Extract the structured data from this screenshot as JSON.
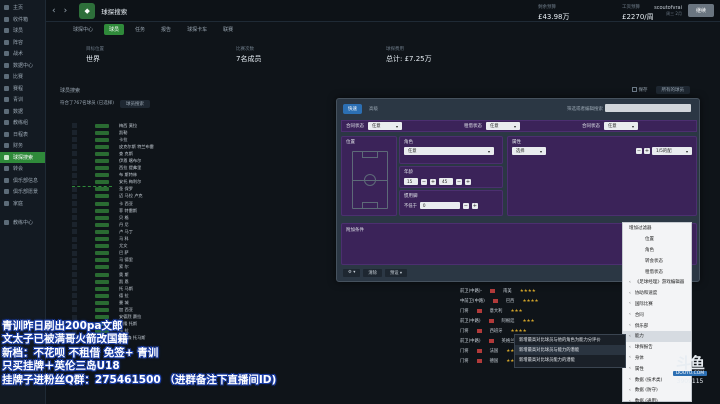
{
  "sidebar": {
    "items": [
      {
        "label": "主页"
      },
      {
        "label": "收件箱"
      },
      {
        "label": "球员"
      },
      {
        "label": "阵容"
      },
      {
        "label": "战术"
      },
      {
        "label": "数据中心"
      },
      {
        "label": "比赛"
      },
      {
        "label": "赛程"
      },
      {
        "label": "青训"
      },
      {
        "label": "数据"
      },
      {
        "label": "教练组"
      },
      {
        "label": "日程表"
      },
      {
        "label": "财务"
      },
      {
        "label": "球探搜索"
      },
      {
        "label": "转会"
      },
      {
        "label": "俱乐部信息"
      },
      {
        "label": "俱乐部愿景"
      },
      {
        "label": "家庭"
      },
      {
        "label": "教练中心"
      }
    ],
    "active_index": 13,
    "accent": "#2f8a3a"
  },
  "topbar": {
    "title": "球探搜索",
    "subtitle": "",
    "user_name": "scoutofvrai",
    "user_sub": "周三 2月",
    "continue_label": "继续"
  },
  "tabs": [
    {
      "label": "球探中心"
    },
    {
      "label": "球员"
    },
    {
      "label": "任务"
    },
    {
      "label": "报告"
    },
    {
      "label": "球探卡车"
    },
    {
      "label": "联赛"
    }
  ],
  "tabs_active_index": 1,
  "stats": [
    {
      "label": "目标位置",
      "value": "世界",
      "sub": ""
    },
    {
      "label": "比赛次数",
      "value": "7名成员",
      "sub": ""
    },
    {
      "label": "球探费用",
      "value": "总计: £7.25万",
      "sub": ""
    }
  ],
  "stats_right": [
    {
      "label": "剩余预算",
      "value": "£43.98万"
    },
    {
      "label": "工资预算",
      "value": "£2270/周"
    }
  ],
  "list": {
    "header": "球员搜索",
    "save_label": "保存",
    "dropdown_label": "所有的球员",
    "save_box": "符合了767名球员 (已选择)",
    "filter_dropdown": "球员搜索"
  },
  "players": [
    "梅西 莫拉",
    "凯勒",
    "卡拉",
    "皮克尔斯 特兰布雷",
    "查 克斯",
    "伊恩 喀布尔",
    "西拉 提弗里",
    "布 斯特林",
    "安托 梅利尔",
    "圣 保罗",
    "迈 马拉 卢克",
    "卡 西亚",
    "菲 特雷斯",
    "贝 格",
    "丹 尼",
    "卢 马丁",
    "马 科",
    "尤文",
    "巴 萨",
    "马 德里",
    "索 尔",
    "奥 斯",
    "凯 恩",
    "托 马斯",
    "德 拉",
    "曼 城",
    "加 西亚",
    "安德烈 赛拉",
    "阿隆 托斯",
    "卡 拉",
    "赫德森 托马斯"
  ],
  "lower_rows": [
    {
      "pos": "前卫(中路)-",
      "name": "南美",
      "stars": "★★★★"
    },
    {
      "pos": "中前卫(中路)",
      "name": "巴西",
      "stars": "★★★★"
    },
    {
      "pos": "门将",
      "name": "意大利",
      "stars": "★★★"
    },
    {
      "pos": "前卫(中路)",
      "name": "阿根廷",
      "stars": "★★★"
    },
    {
      "pos": "门将",
      "name": "西班牙",
      "stars": "★★★★"
    },
    {
      "pos": "前卫(中路)",
      "name": "英格兰",
      "stars": "★★★"
    },
    {
      "pos": "门将",
      "name": "法国",
      "stars": "★★★"
    },
    {
      "pos": "门将",
      "name": "德国",
      "stars": "★★★"
    }
  ],
  "modal": {
    "tabs": [
      {
        "label": "快速"
      },
      {
        "label": "高级"
      }
    ],
    "active_tab": 0,
    "search_label": "筛选或者编辑搜索",
    "row1": [
      {
        "label": "合同状态",
        "value": "任意"
      },
      {
        "label": "租借状态",
        "value": "任意"
      },
      {
        "label": "合同状态",
        "value": "任意"
      }
    ],
    "position_label": "位置",
    "role_label": "角色",
    "role_value": "任意",
    "age_label": "年龄",
    "age_min": "15",
    "age_max": "45",
    "attr_label": "属性",
    "attr_value": "选择",
    "attr_level": "1/5的配",
    "foot_label": "惯用脚",
    "foot_sub": "不低于",
    "foot_value": "0",
    "extra_label": "附加条件",
    "extra_dropdown": "增加过滤器",
    "footer_buttons": [
      {
        "label": "⚙ ▾"
      },
      {
        "label": "清除"
      },
      {
        "label": "预设 ▾"
      }
    ]
  },
  "dropdown_items": [
    {
      "label": "增加过滤器",
      "chev": "",
      "indent": false,
      "hl": false
    },
    {
      "label": "位置",
      "chev": "",
      "indent": true,
      "hl": false
    },
    {
      "label": "角色",
      "chev": "",
      "indent": true,
      "hl": false
    },
    {
      "label": "转会状态",
      "chev": "",
      "indent": true,
      "hl": false
    },
    {
      "label": "租借状态",
      "chev": "",
      "indent": true,
      "hl": false
    },
    {
      "label": "《足球经理》游戏编辑器",
      "chev": "‹",
      "indent": false,
      "hl": false
    },
    {
      "label": "协助和速度",
      "chev": "‹",
      "indent": false,
      "hl": false
    },
    {
      "label": "国际比赛",
      "chev": "‹",
      "indent": false,
      "hl": false
    },
    {
      "label": "合同",
      "chev": "‹",
      "indent": false,
      "hl": false
    },
    {
      "label": "俱乐部",
      "chev": "‹",
      "indent": false,
      "hl": false
    },
    {
      "label": "能力",
      "chev": "‹",
      "indent": false,
      "hl": true
    },
    {
      "label": "球探报告",
      "chev": "‹",
      "indent": false,
      "hl": false
    },
    {
      "label": "身体",
      "chev": "‹",
      "indent": false,
      "hl": false
    },
    {
      "label": "属性",
      "chev": "‹",
      "indent": false,
      "hl": false
    },
    {
      "label": "数据 (技术类)",
      "chev": "‹",
      "indent": false,
      "hl": false
    },
    {
      "label": "数据 (防守)",
      "chev": "‹",
      "indent": false,
      "hl": false
    },
    {
      "label": "数据 (通用)",
      "chev": "‹",
      "indent": false,
      "hl": false
    }
  ],
  "context_menu": [
    {
      "label": "新增最高对比球员与他的角色为能力分评价",
      "hl": false
    },
    {
      "label": "新增最高对比球员与能力的潜能",
      "hl": true
    },
    {
      "label": "新增最高对比球员能力的潜能",
      "hl": false
    }
  ],
  "overlay_lines": [
    "青训昨日刷出200pa文郎",
    "文太子已被满哥火箭改国籍",
    "新档：不花呗 不租借  免签+ 青训",
    "只买挂牌＋英伦三岛U18",
    "挂牌子进粉丝Q群：275461500 （进群备注下直播间ID)"
  ],
  "watermark": {
    "logo": "斗鱼",
    "tag": "DOUYU.COM",
    "id": "3909115"
  }
}
